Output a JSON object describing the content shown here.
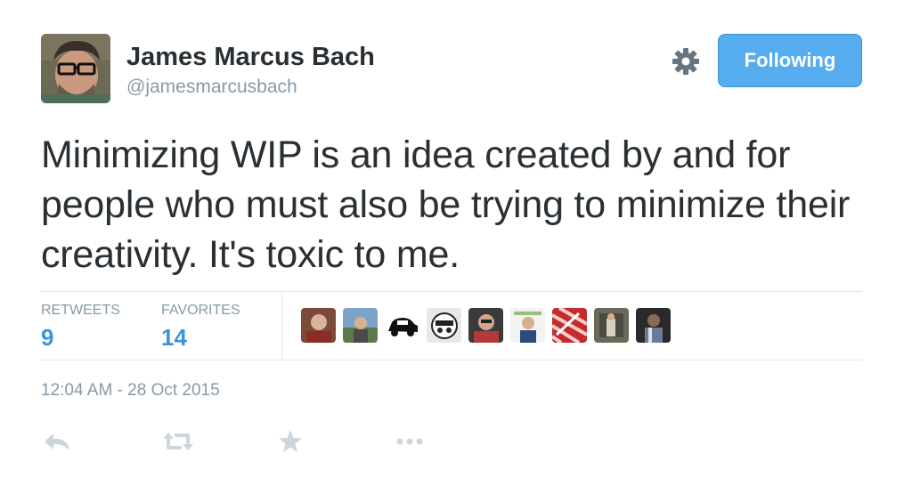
{
  "author": {
    "name": "James Marcus Bach",
    "handle": "@jamesmarcusbach"
  },
  "follow_button": {
    "label": "Following"
  },
  "tweet": {
    "text": "Minimizing WIP is an idea created by and for people who must also be trying to minimize their creativity. It's toxic to me."
  },
  "stats": {
    "retweets_label": "RETWEETS",
    "retweets_count": "9",
    "favorites_label": "FAVORITES",
    "favorites_count": "14"
  },
  "timestamp": "12:04 AM - 28 Oct 2015",
  "colors": {
    "accent": "#55acee",
    "link": "#3b94d9",
    "muted": "#8899a6",
    "text": "#292f33",
    "icon": "#ccd6dd"
  },
  "icons": [
    "gear-icon",
    "reply-icon",
    "retweet-icon",
    "favorite-icon",
    "more-icon"
  ]
}
